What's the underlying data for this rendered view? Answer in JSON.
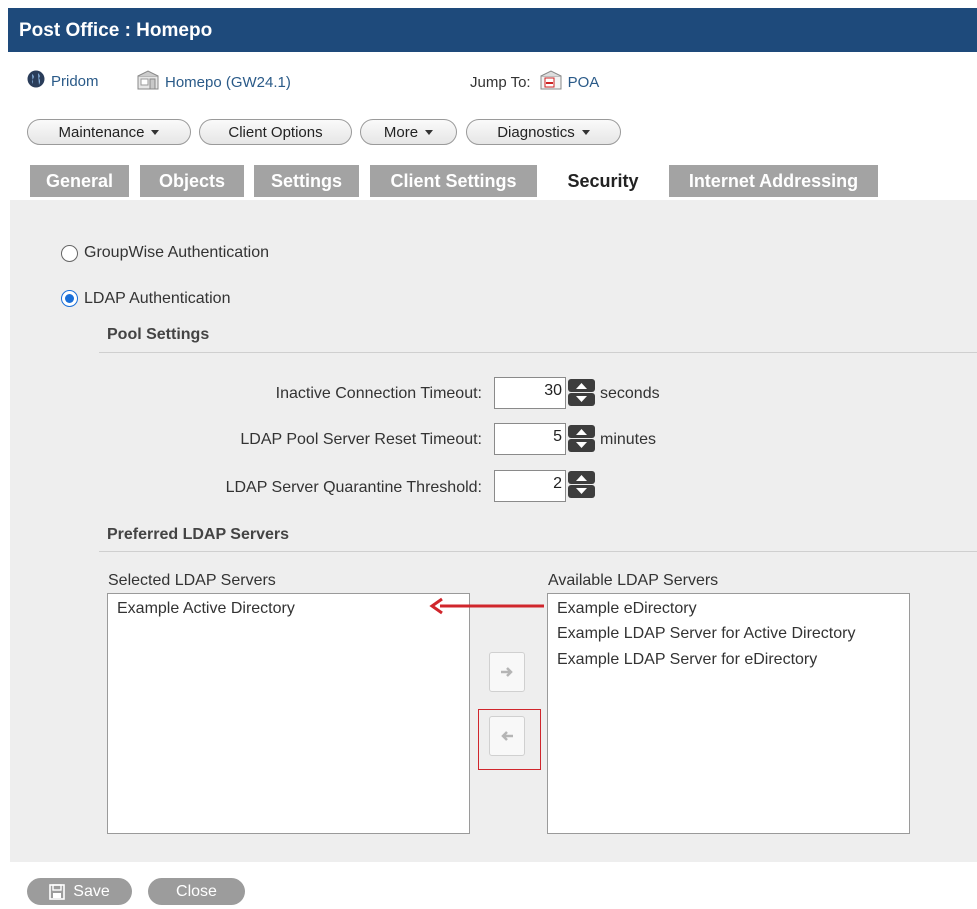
{
  "window": {
    "title": "Post Office : Homepo"
  },
  "breadcrumb": {
    "domain_label": "Pridom",
    "postoffice_label": "Homepo (GW24.1)",
    "jump_label": "Jump To:",
    "jump_target": "POA"
  },
  "toolbar": {
    "maintenance": "Maintenance",
    "client_options": "Client Options",
    "more": "More",
    "diagnostics": "Diagnostics"
  },
  "tabs": [
    "General",
    "Objects",
    "Settings",
    "Client Settings",
    "Security",
    "Internet Addressing"
  ],
  "active_tab": "Security",
  "auth": {
    "groupwise_label": "GroupWise Authentication",
    "ldap_label": "LDAP Authentication",
    "selected": "LDAP Authentication"
  },
  "pool_settings": {
    "heading": "Pool Settings",
    "inactive_timeout": {
      "label": "Inactive Connection Timeout:",
      "value": "30",
      "unit": "seconds"
    },
    "reset_timeout": {
      "label": "LDAP Pool Server Reset Timeout:",
      "value": "5",
      "unit": "minutes"
    },
    "quarantine": {
      "label": "LDAP Server Quarantine Threshold:",
      "value": "2"
    }
  },
  "preferred": {
    "heading": "Preferred LDAP Servers",
    "selected_title": "Selected LDAP Servers",
    "available_title": "Available LDAP Servers",
    "selected_items": [
      "Example Active Directory"
    ],
    "available_items": [
      "Example eDirectory",
      "Example LDAP Server for Active Directory",
      "Example LDAP Server for eDirectory"
    ]
  },
  "footer": {
    "save": "Save",
    "close": "Close"
  },
  "colors": {
    "title_bar": "#1e4a7b",
    "tab_inactive": "#a3a3a3",
    "annotation_red": "#d0262c",
    "radio_selected": "#1a6fd8"
  }
}
